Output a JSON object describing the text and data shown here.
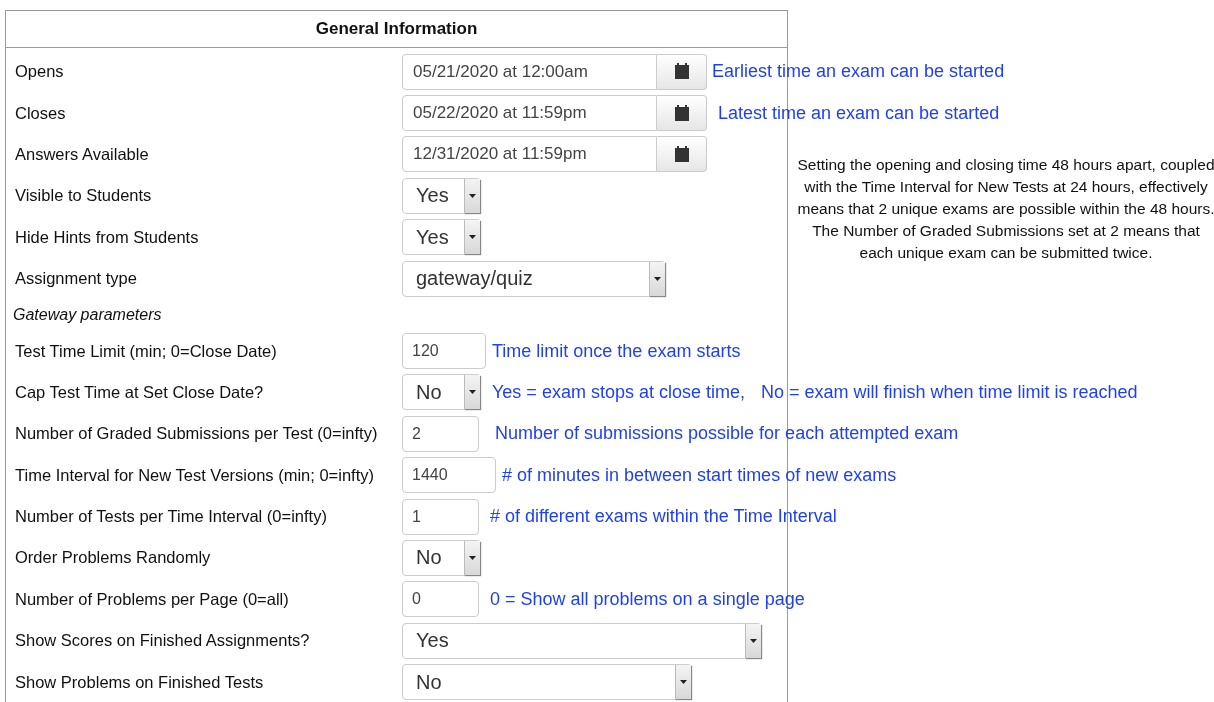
{
  "panel": {
    "title": "General Information"
  },
  "rows": [
    {
      "kind": "date",
      "label": "Opens",
      "value": "05/21/2020 at 12:00am",
      "notes": [
        "Earliest time an exam can be started"
      ]
    },
    {
      "kind": "date",
      "label": "Closes",
      "value": "05/22/2020 at 11:59pm",
      "notes": [
        "Latest time an exam can be started"
      ]
    },
    {
      "kind": "date",
      "label": "Answers Available",
      "value": "12/31/2020 at 11:59pm"
    },
    {
      "kind": "select",
      "label": "Visible to Students",
      "value": "Yes"
    },
    {
      "kind": "select",
      "label": "Hide Hints from Students",
      "value": "Yes"
    },
    {
      "kind": "select",
      "label": "Assignment type",
      "value": "gateway/quiz"
    },
    {
      "kind": "section",
      "label": "Gateway parameters"
    },
    {
      "kind": "text",
      "label": "Test Time Limit (min; 0=Close Date)",
      "value": "120",
      "notes": [
        "Time limit once the exam starts"
      ]
    },
    {
      "kind": "select",
      "label": "Cap Test Time at Set Close Date?",
      "value": "No",
      "notes": [
        "Yes = exam stops at close time,",
        "No = exam will finish when time limit is reached"
      ]
    },
    {
      "kind": "text",
      "label": "Number of Graded Submissions per Test (0=infty)",
      "value": "2",
      "notes": [
        "Number of submissions possible for each attempted exam"
      ]
    },
    {
      "kind": "text",
      "label": "Time Interval for New Test Versions (min; 0=infty)",
      "value": "1440",
      "notes": [
        "# of minutes in between start times of new exams"
      ]
    },
    {
      "kind": "text",
      "label": "Number of Tests per Time Interval (0=infty)",
      "value": "1",
      "notes": [
        "# of different exams within the Time Interval"
      ]
    },
    {
      "kind": "select",
      "label": "Order Problems Randomly",
      "value": "No"
    },
    {
      "kind": "text",
      "label": "Number of Problems per Page (0=all)",
      "value": "0",
      "notes": [
        "0 = Show all problems on a single page"
      ]
    },
    {
      "kind": "select",
      "label": "Show Scores on Finished Assignments?",
      "value": "Yes"
    },
    {
      "kind": "select",
      "label": "Show Problems on Finished Tests",
      "value": "No"
    }
  ],
  "side_note": "Setting the opening and closing time 48 hours apart, coupled with the Time Interval for New Tests at 24 hours, effectively means that 2 unique exams are possible within the 48 hours.  The Number of Graded Submissions set at 2 means that each unique exam can be submitted twice."
}
